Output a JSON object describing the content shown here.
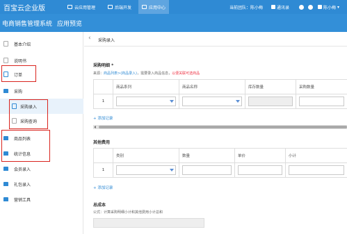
{
  "topbar": {
    "logo": "百宝云企业版",
    "tabs": [
      {
        "label": "云应用管理"
      },
      {
        "label": "后端开发"
      },
      {
        "label": "应用中心"
      }
    ],
    "team_label": "当前团队：",
    "team_name": "陈小梅",
    "contacts": "通讯录",
    "user": "陈小梅"
  },
  "subbar": {
    "system_name": "电商销售管理系统",
    "preview": "应用预览"
  },
  "sidebar": {
    "items": [
      {
        "label": "基本介绍"
      },
      {
        "label": "说明书"
      },
      {
        "label": "订单"
      },
      {
        "label": "采购"
      },
      {
        "label": "采购录入"
      },
      {
        "label": "采购查询"
      },
      {
        "label": "商品列表"
      },
      {
        "label": "统计信息"
      },
      {
        "label": "会员录入"
      },
      {
        "label": "礼包录入"
      },
      {
        "label": "营销工具"
      }
    ]
  },
  "breadcrumb": {
    "back": "‹",
    "title": "采购录入"
  },
  "purchase": {
    "title": "采购明细 *",
    "hint_prefix": "来源：",
    "hint_source": "商品列表>(商品录入)",
    "hint_mid": "，需要录入商品信息，",
    "hint_red": "以便关联可选商品",
    "columns": [
      "",
      "商品系列",
      "商品名称",
      "库存数量",
      "采购数量"
    ],
    "row_no": "1",
    "add": "+ 添加记录"
  },
  "other_cost": {
    "title": "其他费用",
    "columns": [
      "",
      "类别",
      "数量",
      "单价",
      "小计"
    ],
    "row_no": "1",
    "add": "+ 添加记录"
  },
  "total": {
    "title": "总成本",
    "formula": "公式：计算采购明细小计和其他费用小计总和"
  }
}
